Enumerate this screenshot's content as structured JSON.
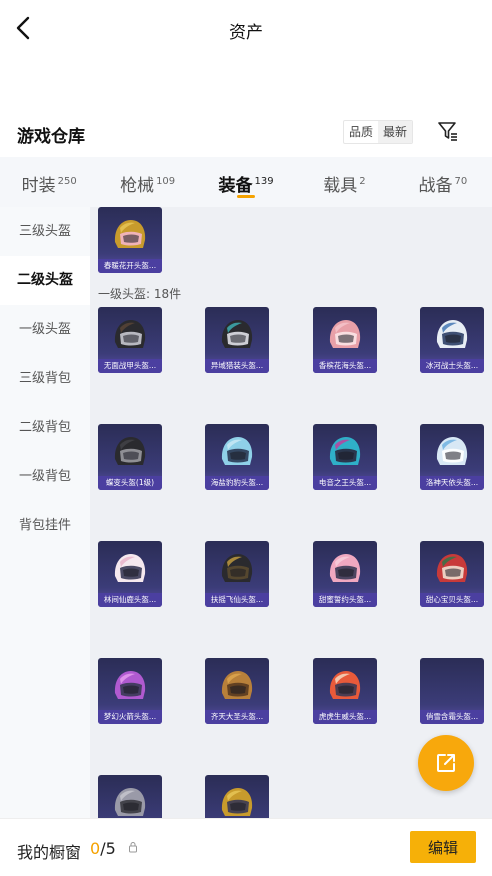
{
  "header": {
    "title": "资产"
  },
  "section": {
    "title": "游戏仓库",
    "sort": [
      "品质",
      "最新"
    ]
  },
  "tabs": [
    {
      "label": "时装",
      "count": "250"
    },
    {
      "label": "枪械",
      "count": "109"
    },
    {
      "label": "装备",
      "count": "139"
    },
    {
      "label": "载具",
      "count": "2"
    },
    {
      "label": "战备",
      "count": "70"
    }
  ],
  "sidebar": {
    "items": [
      "三级头盔",
      "二级头盔",
      "一级头盔",
      "三级背包",
      "二级背包",
      "一级背包",
      "背包挂件"
    ]
  },
  "content": {
    "level2_items": [
      {
        "name": "春暖花开头盔...",
        "palette": [
          "#c89b2c",
          "#e8c85a",
          "#f4b6c8"
        ]
      }
    ],
    "group_label": "一级头盔: 18件",
    "items": [
      {
        "name": "无面战甲头盔...",
        "palette": [
          "#2a2a2e",
          "#5b4637",
          "#c8c8d0"
        ]
      },
      {
        "name": "异域猎装头盔...",
        "palette": [
          "#2a2a2e",
          "#3fb5b8",
          "#e0e0e8"
        ]
      },
      {
        "name": "香槟花海头盔...",
        "palette": [
          "#e8a0a8",
          "#f5c6cc",
          "#fbe4e6"
        ]
      },
      {
        "name": "冰河战士头盔...",
        "palette": [
          "#e8eef5",
          "#3a6fb0",
          "#2c3e66"
        ]
      },
      {
        "name": "蝶变头盔(1级)",
        "palette": [
          "#2a2a2e",
          "#444448",
          "#9a9aa0"
        ]
      },
      {
        "name": "海盐豹豹头盔...",
        "palette": [
          "#8fd0e8",
          "#cceaf5",
          "#2b3a55"
        ]
      },
      {
        "name": "电音之王头盔...",
        "palette": [
          "#2fb0c8",
          "#c83a9a",
          "#2a2a40"
        ]
      },
      {
        "name": "洛神天依头盔...",
        "palette": [
          "#d8e8f5",
          "#6aaee0",
          "#ffffff"
        ]
      },
      {
        "name": "林间仙鹿头盔...",
        "palette": [
          "#f5e8ee",
          "#e8b0c8",
          "#3a3a55"
        ]
      },
      {
        "name": "扶摇飞仙头盔...",
        "palette": [
          "#2a2a2e",
          "#c8a040",
          "#5a4a30"
        ]
      },
      {
        "name": "甜蜜誓约头盔...",
        "palette": [
          "#f0a8c0",
          "#f8d0dc",
          "#3a3a55"
        ]
      },
      {
        "name": "甜心宝贝头盔...",
        "palette": [
          "#c83a3a",
          "#2a7a4a",
          "#f0e0d0"
        ]
      },
      {
        "name": "梦幻火箭头盔...",
        "palette": [
          "#b05ad0",
          "#e8a0f0",
          "#3a3a55"
        ]
      },
      {
        "name": "齐天大圣头盔...",
        "palette": [
          "#b8803a",
          "#e0a850",
          "#5a3a20"
        ]
      },
      {
        "name": "虎虎生威头盔...",
        "palette": [
          "#e85a3a",
          "#f5e0c8",
          "#3a3a55"
        ]
      },
      {
        "name": "俏雪含霜头盔...",
        "palette": null
      },
      {
        "name": "",
        "palette": [
          "#9a9aa8",
          "#c8c8d0",
          "#3a3a40"
        ]
      },
      {
        "name": "",
        "palette": [
          "#c89b2c",
          "#e8c85a",
          "#3a3a55"
        ]
      }
    ]
  },
  "bottom": {
    "label": "我的橱窗",
    "current": "0",
    "total": "/5",
    "edit": "编辑"
  },
  "colors": {
    "accent": "#f5a200",
    "card_top": "#2b2d56",
    "card_label": "#4b3fa0"
  },
  "icons": {
    "back": "chevron-left-icon",
    "filter": "filter-icon",
    "share": "share-external-icon",
    "lock": "lock-icon"
  }
}
